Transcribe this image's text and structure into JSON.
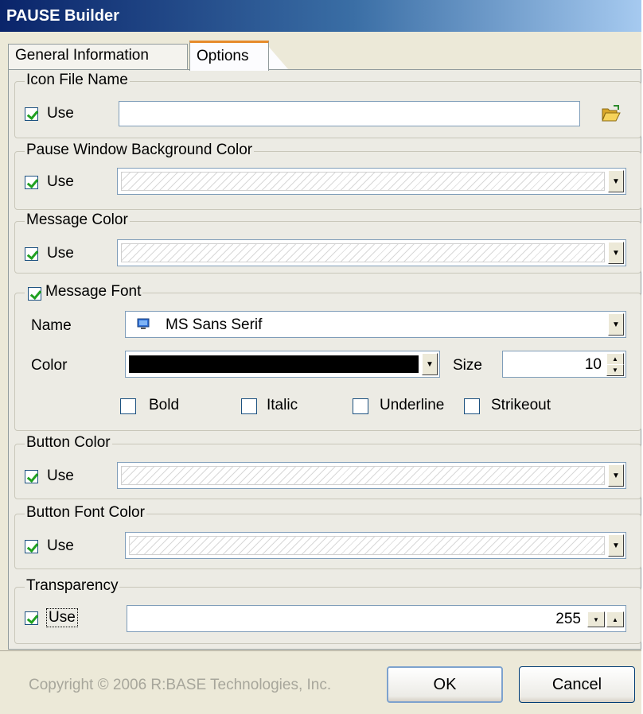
{
  "window": {
    "title": "PAUSE Builder"
  },
  "tabs": [
    {
      "label": "General Information"
    },
    {
      "label": "Options"
    }
  ],
  "icon_file": {
    "legend": "Icon File Name",
    "use_label": "Use",
    "use_checked": true,
    "value": ""
  },
  "pause_bg": {
    "legend": "Pause Window Background Color",
    "use_label": "Use",
    "use_checked": true
  },
  "message_color": {
    "legend": "Message Color",
    "use_label": "Use",
    "use_checked": true
  },
  "message_font": {
    "legend": "Message Font",
    "checked": true,
    "name_label": "Name",
    "name_value": "MS Sans Serif",
    "color_label": "Color",
    "color_value": "#000000",
    "size_label": "Size",
    "size_value": "10",
    "bold_label": "Bold",
    "italic_label": "Italic",
    "underline_label": "Underline",
    "strikeout_label": "Strikeout"
  },
  "button_color": {
    "legend": "Button Color",
    "use_label": "Use",
    "use_checked": true
  },
  "button_font_color": {
    "legend": "Button Font Color",
    "use_label": "Use",
    "use_checked": true
  },
  "transparency": {
    "legend": "Transparency",
    "use_label": "Use",
    "use_checked": true,
    "value": "255"
  },
  "footer": {
    "copyright": "Copyright © 2006 R:BASE Technologies, Inc.",
    "ok_label": "OK",
    "cancel_label": "Cancel"
  }
}
